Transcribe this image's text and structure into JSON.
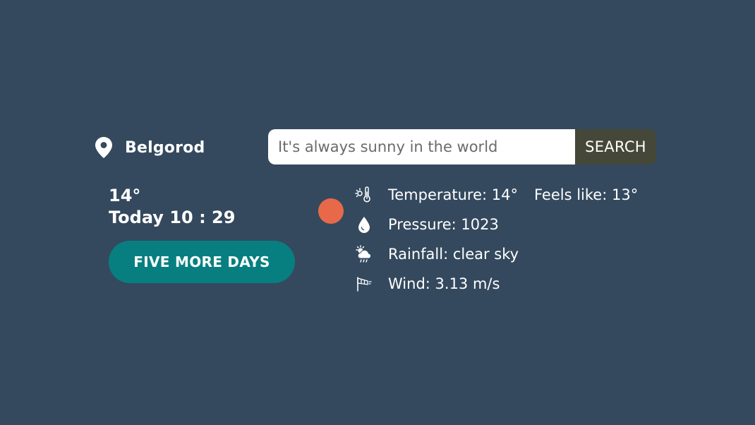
{
  "location": {
    "icon": "map-pin-icon",
    "city": "Belgorod"
  },
  "search": {
    "placeholder": "It's always sunny in the world",
    "value": "",
    "button_label": "SEARCH"
  },
  "summary": {
    "temperature": "14°",
    "datetime": "Today 10 : 29"
  },
  "five_days_button": "FIVE MORE DAYS",
  "weather_indicator": {
    "icon": "sun-icon",
    "color": "#e8694a"
  },
  "details": {
    "temperature": "Temperature: 14°",
    "feels_like": "Feels like: 13°",
    "pressure": "Pressure: 1023",
    "rainfall": "Rainfall: clear sky",
    "wind": "Wind: 3.13 m/s"
  },
  "colors": {
    "background": "#34495e",
    "search_button": "#454838",
    "five_days_button": "#077f80",
    "text": "#ffffff"
  }
}
